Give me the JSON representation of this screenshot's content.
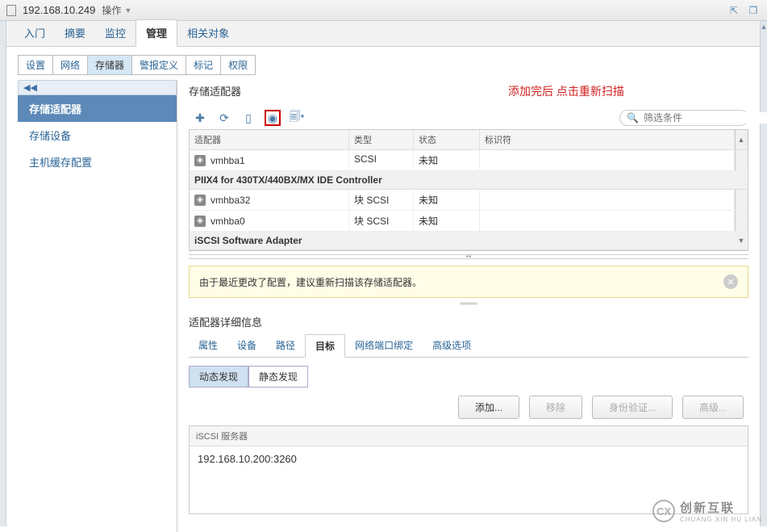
{
  "titlebar": {
    "ip": "192.168.10.249",
    "actions": "操作"
  },
  "main_tabs": [
    "入门",
    "摘要",
    "监控",
    "管理",
    "相关对象"
  ],
  "main_tab_active_index": 3,
  "sub_tabs": [
    "设置",
    "网络",
    "存储器",
    "警报定义",
    "标记",
    "权限"
  ],
  "sub_tab_active_index": 2,
  "sidebar": {
    "items": [
      "存储适配器",
      "存储设备",
      "主机缓存配置"
    ],
    "active_index": 0
  },
  "section": {
    "title": "存储适配器",
    "red_note": "添加完后 点击重新扫描",
    "filter_placeholder": "筛选条件"
  },
  "grid_headers": {
    "adapter": "适配器",
    "type": "类型",
    "status": "状态",
    "id": "标识符"
  },
  "adapters": [
    {
      "kind": "row",
      "name": "vmhba1",
      "type": "SCSI",
      "status": "未知"
    },
    {
      "kind": "group",
      "label": "PIIX4 for 430TX/440BX/MX IDE Controller"
    },
    {
      "kind": "row",
      "name": "vmhba32",
      "type": "块 SCSI",
      "status": "未知"
    },
    {
      "kind": "row",
      "name": "vmhba0",
      "type": "块 SCSI",
      "status": "未知"
    },
    {
      "kind": "group",
      "label": "iSCSI Software Adapter"
    }
  ],
  "alert": {
    "text": "由于最近更改了配置，建议重新扫描该存储适配器。"
  },
  "details": {
    "title": "适配器详细信息",
    "tabs": [
      "属性",
      "设备",
      "路径",
      "目标",
      "网络端口绑定",
      "高级选项"
    ],
    "active_tab_index": 3,
    "discover_tabs": [
      "动态发现",
      "静态发现"
    ],
    "discover_active_index": 0,
    "buttons": {
      "add": "添加...",
      "remove": "移除",
      "auth": "身份验证...",
      "advanced": "高级..."
    },
    "server_header": "iSCSI 服务器",
    "server_value": "192.168.10.200:3260"
  },
  "watermark": {
    "cn": "创新互联",
    "py": "CHUANG XIN HU LIAN",
    "logo": "CX"
  }
}
